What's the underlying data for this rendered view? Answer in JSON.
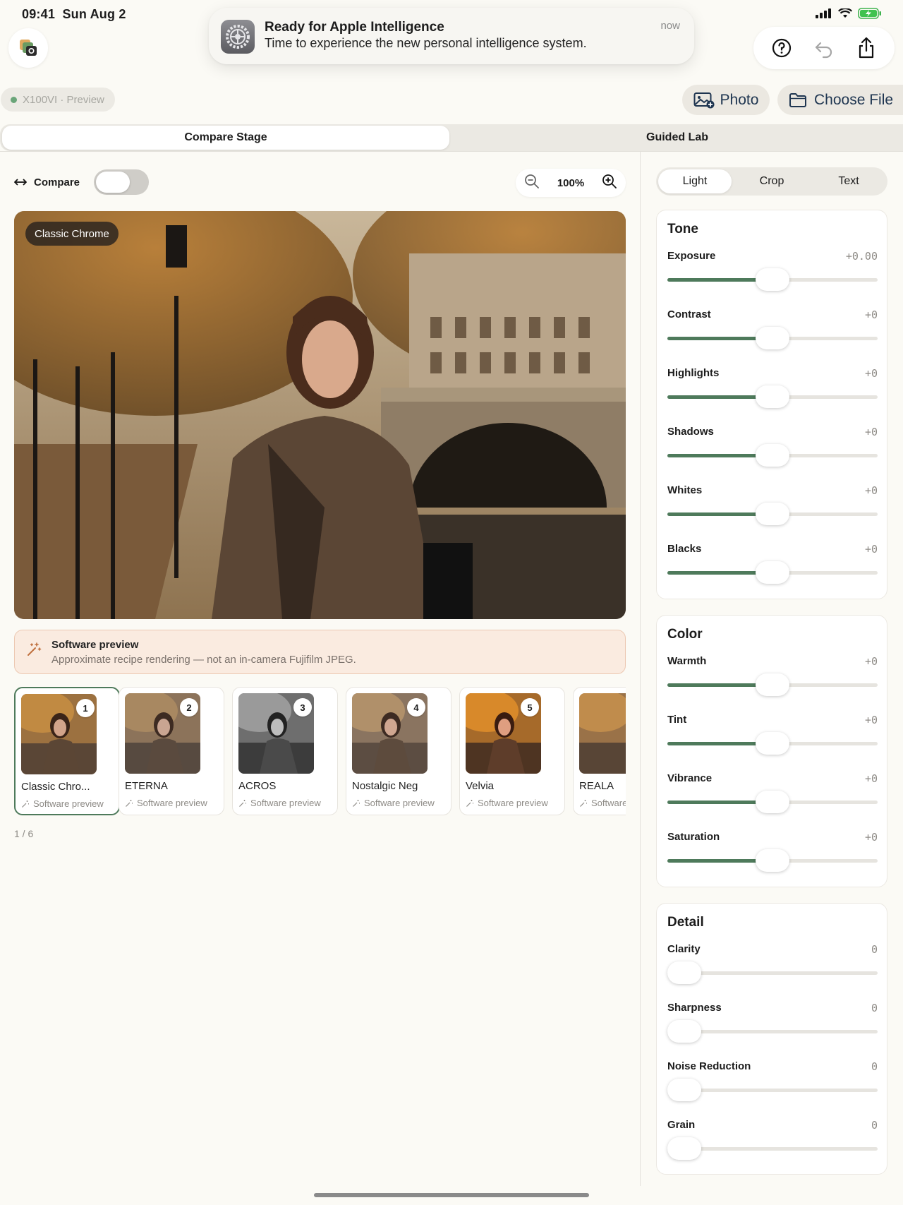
{
  "status_bar": {
    "time": "09:41",
    "date": "Sun Aug 2"
  },
  "notification": {
    "title": "Ready for Apple Intelligence",
    "body": "Time to experience the new personal intelligence system.",
    "time": "now"
  },
  "camera_chip": {
    "label": "X100VI · Preview"
  },
  "toolbar": {
    "photo_label": "Photo",
    "file_label": "Choose File"
  },
  "mode_tabs": [
    {
      "label": "Compare Stage",
      "active": true
    },
    {
      "label": "Guided Lab",
      "active": false
    }
  ],
  "compare": {
    "label": "Compare",
    "enabled": false,
    "zoom": "100%"
  },
  "photo": {
    "simulation_label": "Classic Chrome"
  },
  "banner": {
    "title": "Software preview",
    "subtitle": "Approximate recipe rendering — not an in-camera Fujifilm JPEG."
  },
  "recipes": [
    {
      "num": "1",
      "name": "Classic Chro...",
      "sub": "Software preview",
      "style": "color"
    },
    {
      "num": "2",
      "name": "ETERNA",
      "sub": "Software preview",
      "style": "muted"
    },
    {
      "num": "3",
      "name": "ACROS",
      "sub": "Software preview",
      "style": "bw"
    },
    {
      "num": "4",
      "name": "Nostalgic Neg",
      "sub": "Software preview",
      "style": "muted"
    },
    {
      "num": "5",
      "name": "Velvia",
      "sub": "Software preview",
      "style": "vivid"
    },
    {
      "num": "",
      "name": "REALA",
      "sub": "Software preview",
      "style": "color"
    }
  ],
  "pager": "1 / 6",
  "panel_tabs": [
    {
      "label": "Light",
      "active": true
    },
    {
      "label": "Crop",
      "active": false
    },
    {
      "label": "Text",
      "active": false
    }
  ],
  "groups": [
    {
      "title": "Tone",
      "sliders": [
        {
          "label": "Exposure",
          "value": "+0.00",
          "level": 0.5
        },
        {
          "label": "Contrast",
          "value": "+0",
          "level": 0.5
        },
        {
          "label": "Highlights",
          "value": "+0",
          "level": 0.5
        },
        {
          "label": "Shadows",
          "value": "+0",
          "level": 0.5
        },
        {
          "label": "Whites",
          "value": "+0",
          "level": 0.5
        },
        {
          "label": "Blacks",
          "value": "+0",
          "level": 0.5
        }
      ]
    },
    {
      "title": "Color",
      "sliders": [
        {
          "label": "Warmth",
          "value": "+0",
          "level": 0.5
        },
        {
          "label": "Tint",
          "value": "+0",
          "level": 0.5
        },
        {
          "label": "Vibrance",
          "value": "+0",
          "level": 0.5
        },
        {
          "label": "Saturation",
          "value": "+0",
          "level": 0.5
        }
      ]
    },
    {
      "title": "Detail",
      "sliders": [
        {
          "label": "Clarity",
          "value": "0",
          "level": 0
        },
        {
          "label": "Sharpness",
          "value": "0",
          "level": 0
        },
        {
          "label": "Noise Reduction",
          "value": "0",
          "level": 0
        },
        {
          "label": "Grain",
          "value": "0",
          "level": 0
        }
      ]
    }
  ],
  "colors": {
    "accent": "#4e7a5b",
    "background": "#fbfaf5",
    "banner_bg": "#faebe0"
  },
  "icons": [
    "app-logo-icon",
    "help-icon",
    "undo-icon",
    "share-icon",
    "photo-add-icon",
    "folder-icon",
    "compare-arrows-icon",
    "zoom-out-icon",
    "zoom-in-icon",
    "magic-wand-icon"
  ]
}
